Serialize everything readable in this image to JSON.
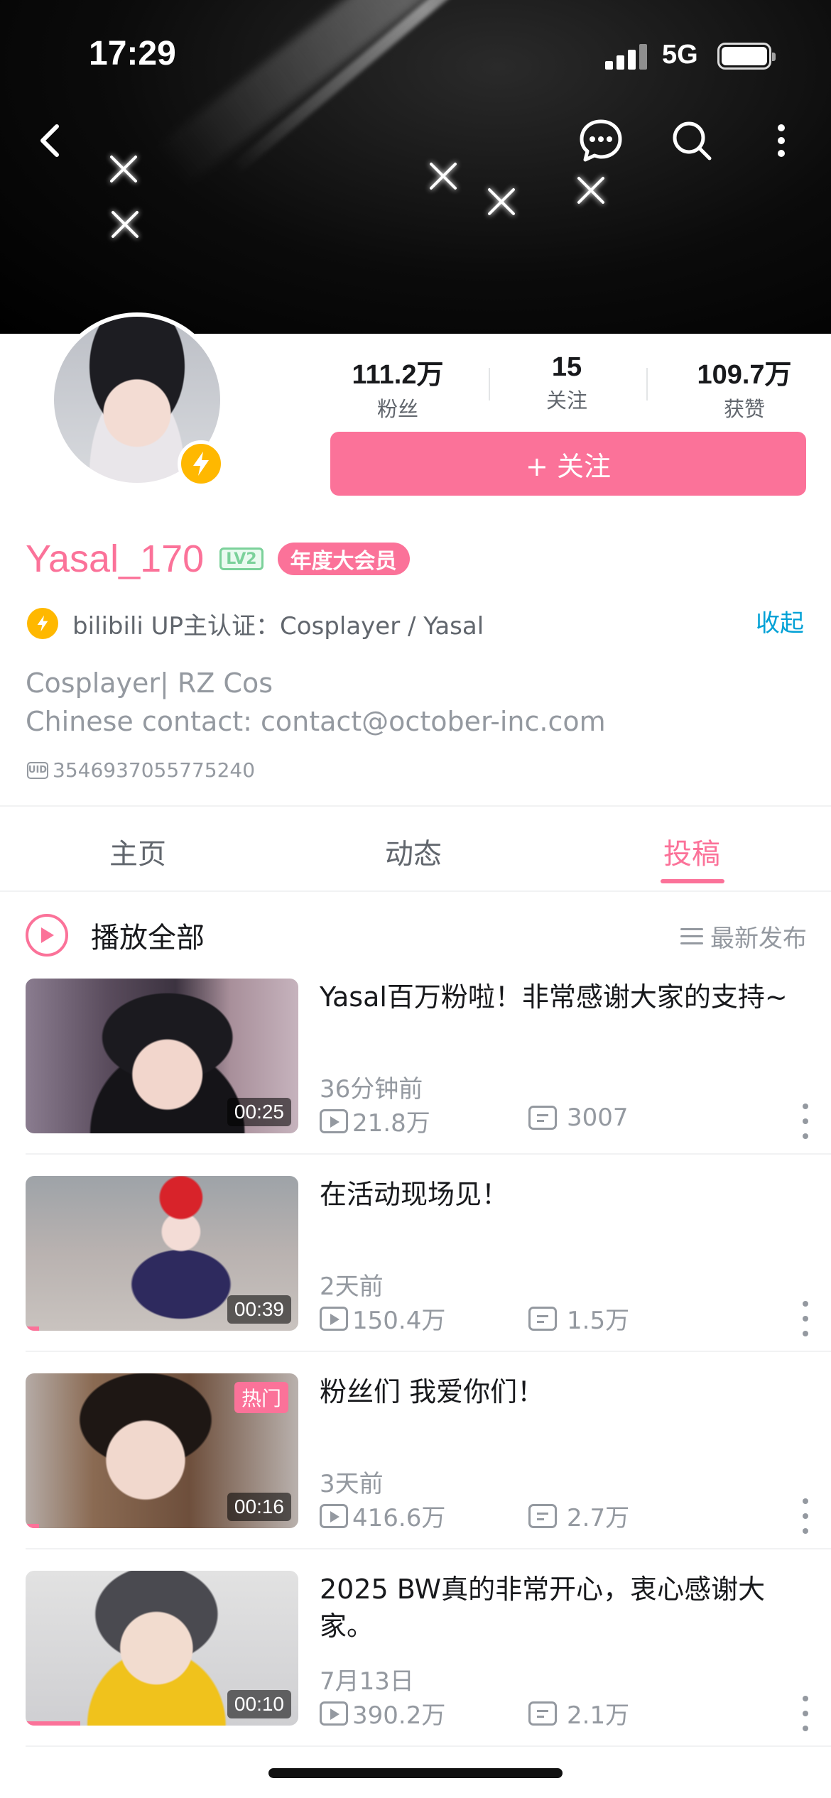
{
  "status_bar": {
    "time": "17:29",
    "network": "5G"
  },
  "header_actions": {
    "back_icon": "chevron-left-icon",
    "message_icon": "chat-bubble-icon",
    "search_icon": "search-icon",
    "more_icon": "vertical-ellipsis-icon"
  },
  "profile": {
    "stats": [
      {
        "value": "111.2万",
        "label": "粉丝"
      },
      {
        "value": "15",
        "label": "关注"
      },
      {
        "value": "109.7万",
        "label": "获赞"
      }
    ],
    "follow_label": "+ 关注",
    "username": "Yasal_170",
    "level": "LV2",
    "vip_badge": "年度大会员",
    "certification": "bilibili UP主认证：Cosplayer / Yasal",
    "collapse_label": "收起",
    "bio_line1": "Cosplayer| RZ Cos",
    "bio_line2": "Chinese contact: contact@october-inc.com",
    "uid_label": "UID",
    "uid": "3546937055775240"
  },
  "tabs": [
    {
      "label": "主页",
      "active": false
    },
    {
      "label": "动态",
      "active": false
    },
    {
      "label": "投稿",
      "active": true
    }
  ],
  "list_header": {
    "play_all": "播放全部",
    "sort": "最新发布"
  },
  "videos": [
    {
      "title": "Yasal百万粉啦！非常感谢大家的支持~",
      "time": "36分钟前",
      "plays": "21.8万",
      "danmaku": "3007",
      "duration": "00:25",
      "tag": "",
      "watched_fraction": 0
    },
    {
      "title": "在活动现场见！",
      "time": "2天前",
      "plays": "150.4万",
      "danmaku": "1.5万",
      "duration": "00:39",
      "tag": "",
      "watched_fraction": 0.05
    },
    {
      "title": "粉丝们 我爱你们！",
      "time": "3天前",
      "plays": "416.6万",
      "danmaku": "2.7万",
      "duration": "00:16",
      "tag": "热门",
      "watched_fraction": 0.05
    },
    {
      "title": "2025 BW真的非常开心，衷心感谢大家。",
      "time": "7月13日",
      "plays": "390.2万",
      "danmaku": "2.1万",
      "duration": "00:10",
      "tag": "",
      "watched_fraction": 0.2
    }
  ],
  "colors": {
    "accent": "#fb7299",
    "link": "#00a1d6",
    "badge": "#ffb800"
  }
}
